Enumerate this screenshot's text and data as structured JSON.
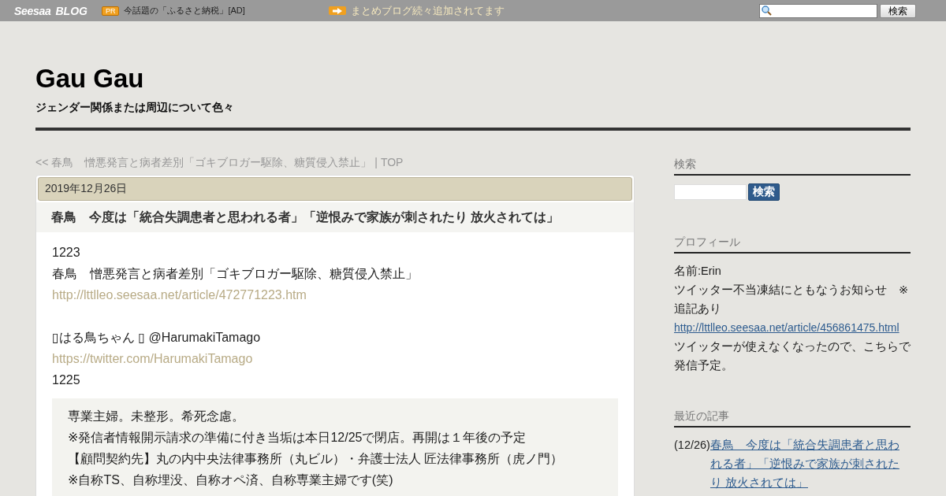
{
  "top_bar": {
    "logo_main": "Seesaa",
    "logo_sub": "BLOG",
    "pr_badge": "PR",
    "ad_text": "今話題の「ふるさと納税」[AD]",
    "notice": "まとめブログ続々追加されてます",
    "search_button": "検索"
  },
  "blog": {
    "title": "Gau Gau",
    "description": "ジェンダー関係または周辺について色々"
  },
  "nav": {
    "prev": "<< 春鳥　憎悪発言と病者差別「ゴキブロガー駆除、糖質侵入禁止」",
    "separator": "|",
    "top": "TOP"
  },
  "entry": {
    "date": "2019年12月26日",
    "title": "春鳥　今度は「統合失調患者と思われる者」「逆恨みで家族が刺されたり 放火されては」",
    "lines": [
      {
        "kind": "text",
        "text": "1223"
      },
      {
        "kind": "text",
        "text": "春鳥　憎悪発言と病者差別「ゴキブロガー駆除、糖質侵入禁止」"
      },
      {
        "kind": "link",
        "text": "http://lttlleo.seesaa.net/article/472771223.htm"
      },
      {
        "kind": "blank"
      },
      {
        "kind": "text",
        "text": "▯はる鳥ちゃん ▯ @HarumakiTamago"
      },
      {
        "kind": "link",
        "text": "https://twitter.com/HarumakiTamago"
      },
      {
        "kind": "text",
        "text": "1225"
      }
    ],
    "quote": [
      "専業主婦。未整形。希死念慮。",
      "※発信者情報開示請求の準備に付き当垢は本日12/25で閉店。再開は１年後の予定",
      "【顧問契約先】丸の内中央法律事務所（丸ビル）・弁護士法人 匠法律事務所（虎ノ門）",
      "※自称TS、自称埋没、自称オペ済、自称専業主婦です(笑)"
    ]
  },
  "sidebar": [
    {
      "kind": "search",
      "heading": "検索",
      "button": "検索"
    },
    {
      "kind": "profile",
      "heading": "プロフィール",
      "lines": [
        {
          "kind": "text",
          "text": "名前:Erin"
        },
        {
          "kind": "text",
          "text": "ツイッター不当凍結にともなうお知らせ　※追記あり"
        },
        {
          "kind": "link",
          "text": "http://lttlleo.seesaa.net/article/456861475.html"
        },
        {
          "kind": "text",
          "text": "ツイッターが使えなくなったので、こちらで発信予定。"
        }
      ]
    },
    {
      "kind": "recent",
      "heading": "最近の記事",
      "items": [
        {
          "date": "(12/26)",
          "title": "春鳥　今度は「統合失調患者と思われる者」「逆恨みで家族が刺されたり 放火されては」"
        }
      ]
    }
  ]
}
